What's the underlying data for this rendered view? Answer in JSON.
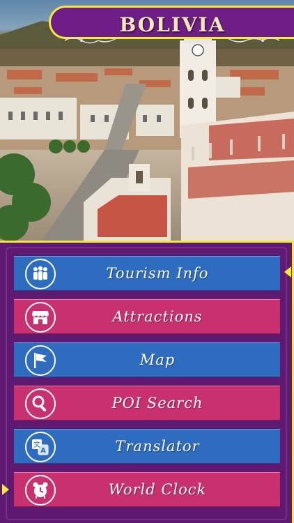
{
  "header": {
    "title": "Bolivia"
  },
  "colors": {
    "panel": "#5e1a71",
    "accent_border": "#f2ea3a",
    "blue_button": "#2e6cc0",
    "pink_button": "#c8306f",
    "title_text": "#f3e9b6"
  },
  "menu": {
    "items": [
      {
        "label": "Tourism Info",
        "icon": "people-group-icon",
        "color": "blue"
      },
      {
        "label": "Attractions",
        "icon": "storefront-icon",
        "color": "pink"
      },
      {
        "label": "Map",
        "icon": "flag-icon",
        "color": "blue"
      },
      {
        "label": "POI Search",
        "icon": "magnifier-icon",
        "color": "pink"
      },
      {
        "label": "Translator",
        "icon": "translate-icon",
        "color": "blue"
      },
      {
        "label": "World Clock",
        "icon": "alarm-clock-icon",
        "color": "pink"
      }
    ]
  }
}
